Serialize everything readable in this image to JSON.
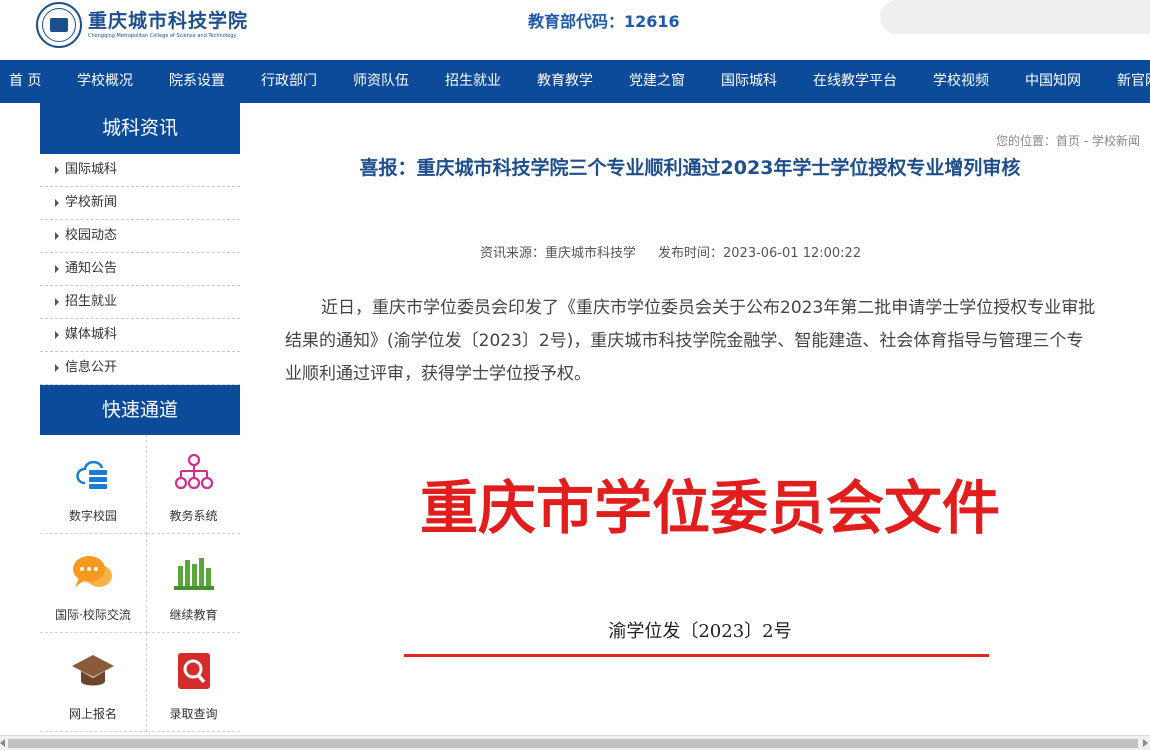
{
  "header": {
    "logo_cn": "重庆城市科技学院",
    "logo_en": "Chongqing Metropolitan College of Science and Technology",
    "edu_code": "教育部代码：12616"
  },
  "nav": {
    "items": [
      "首 页",
      "学校概况",
      "院系设置",
      "行政部门",
      "师资队伍",
      "招生就业",
      "教育教学",
      "党建之窗",
      "国际城科",
      "在线教学平台",
      "学校视频",
      "中国知网",
      "新官网"
    ]
  },
  "sidebar": {
    "news_title": "城科资讯",
    "news_items": [
      "国际城科",
      "学校新闻",
      "校园动态",
      "通知公告",
      "招生就业",
      "媒体城科",
      "信息公开"
    ],
    "quick_title": "快速通道",
    "quick_items": [
      {
        "label": "数字校园",
        "icon": "cloud-server-icon",
        "color": "#1a7bd4"
      },
      {
        "label": "教务系统",
        "icon": "org-chart-icon",
        "color": "#d12f8e"
      },
      {
        "label": "国际·校际交流",
        "icon": "chat-bubbles-icon",
        "color": "#f39a1f"
      },
      {
        "label": "继续教育",
        "icon": "books-icon",
        "color": "#5aa63a"
      },
      {
        "label": "网上报名",
        "icon": "graduation-cap-icon",
        "color": "#8a5a3a"
      },
      {
        "label": "录取查询",
        "icon": "search-doc-icon",
        "color": "#d62b2b"
      }
    ]
  },
  "main": {
    "breadcrumb": "您的位置：首页 - 学校新闻",
    "title": "喜报：重庆城市科技学院三个专业顺利通过2023年学士学位授权专业增列审核",
    "source": "资讯来源：重庆城市科技学",
    "publish_time": "发布时间：2023-06-01 12:00:22",
    "body": "近日，重庆市学位委员会印发了《重庆市学位委员会关于公布2023年第二批申请学士学位授权专业审批结果的通知》(渝学位发〔2023〕2号)，重庆城市科技学院金融学、智能建造、社会体育指导与管理三个专业顺利通过评审，获得学士学位授予权。",
    "doc_title": "重庆市学位委员会文件",
    "doc_number": "渝学位发〔2023〕2号"
  },
  "colors": {
    "brand_blue": "#0c4a9a",
    "title_blue": "#1e4f8c",
    "doc_red": "#e21d1d"
  }
}
